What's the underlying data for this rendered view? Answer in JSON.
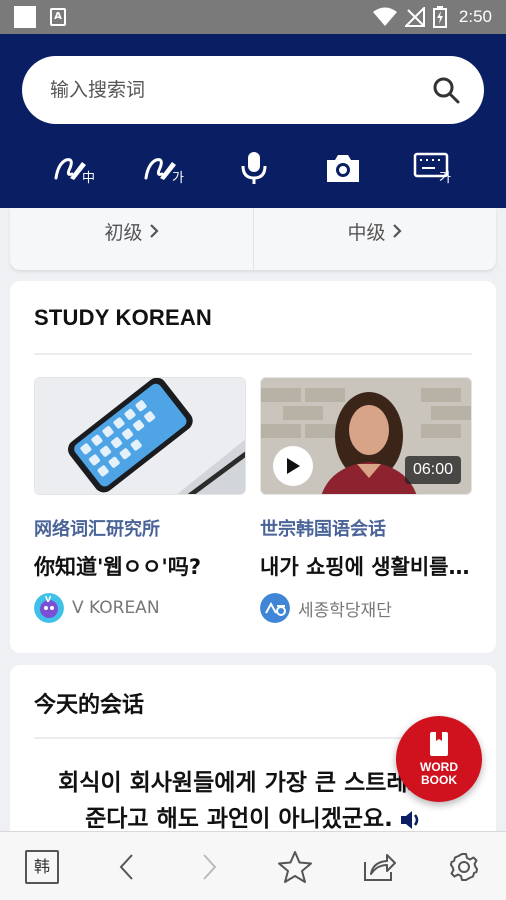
{
  "status_bar": {
    "time": "2:50"
  },
  "search": {
    "placeholder": "输入搜索词"
  },
  "levels": {
    "beginner": "初级",
    "intermediate": "中级"
  },
  "study": {
    "title": "STUDY KOREAN",
    "items": [
      {
        "category": "网络词汇研究所",
        "headline": "你知道'웹ㅇㅇ'吗?",
        "author": "V KOREAN"
      },
      {
        "category": "世宗韩国语会话",
        "headline": "내가 쇼핑에 생활비를 ...",
        "author": "세종학당재단",
        "duration": "06:00"
      }
    ]
  },
  "conversation": {
    "title": "今天的会话",
    "line1": "회식이 회사원들에게 가장 큰 스트레스를",
    "line2": "준다고 해도 과언이 아니겠군요."
  },
  "fab": {
    "line1": "WORD",
    "line2": "BOOK"
  },
  "bottom_bar": {
    "home_label": "韩"
  },
  "colors": {
    "header": "#0a1f63",
    "accent_red": "#d0121f",
    "category": "#4a6499"
  }
}
